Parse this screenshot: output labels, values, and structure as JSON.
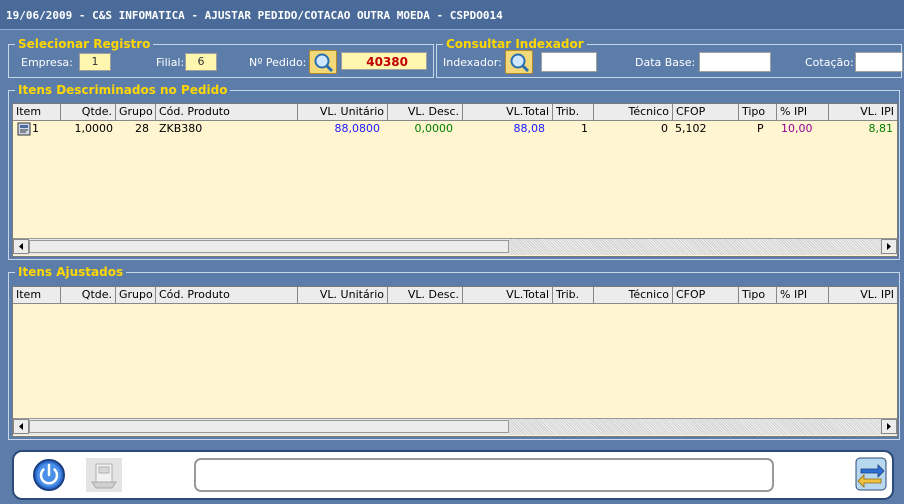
{
  "window": {
    "title": "19/06/2009 - C&S INFOMATICA - AJUSTAR PEDIDO/COTACAO OUTRA MOEDA - CSPDO014"
  },
  "selecionar": {
    "legend": "Selecionar Registro",
    "empresa_label": "Empresa:",
    "empresa_value": "1",
    "filial_label": "Filial:",
    "filial_value": "6",
    "pedido_label": "Nº Pedido:",
    "pedido_value": "40380"
  },
  "consultar": {
    "legend": "Consultar Indexador",
    "indexador_label": "Indexador:",
    "indexador_value": "",
    "data_base_label": "Data Base:",
    "data_base_value": "",
    "cotacao_label": "Cotação:",
    "cotacao_value": ""
  },
  "columns": [
    "Item",
    "Qtde.",
    "Grupo",
    "Cód. Produto",
    "VL. Unitário",
    "VL. Desc.",
    "VL.Total",
    "Trib.",
    "Técnico",
    "CFOP",
    "Tipo",
    "% IPI",
    "VL. IPI"
  ],
  "itens_pedido": {
    "legend": "Itens Descriminados no Pedido",
    "rows": [
      {
        "item": "1",
        "qtde": "1,0000",
        "grupo": "28",
        "cod_produto": "ZKB380",
        "vl_unitario": "88,0800",
        "vl_desc": "0,0000",
        "vl_total": "88,08",
        "trib": "1",
        "tecnico": "0",
        "cfop": "5,102",
        "tipo": "P",
        "pct_ipi": "10,00",
        "vl_ipi": "8,81"
      }
    ]
  },
  "itens_ajustados": {
    "legend": "Itens Ajustados",
    "rows": []
  },
  "footer": {
    "status_text": ""
  },
  "colors": {
    "background": "#5c7daa",
    "legend": "#ffd700",
    "table_bg": "#fff5d1",
    "blue_value": "#1a1aff",
    "green_value": "#008000",
    "purple_value": "#990099",
    "pedido_value": "#c00000"
  }
}
